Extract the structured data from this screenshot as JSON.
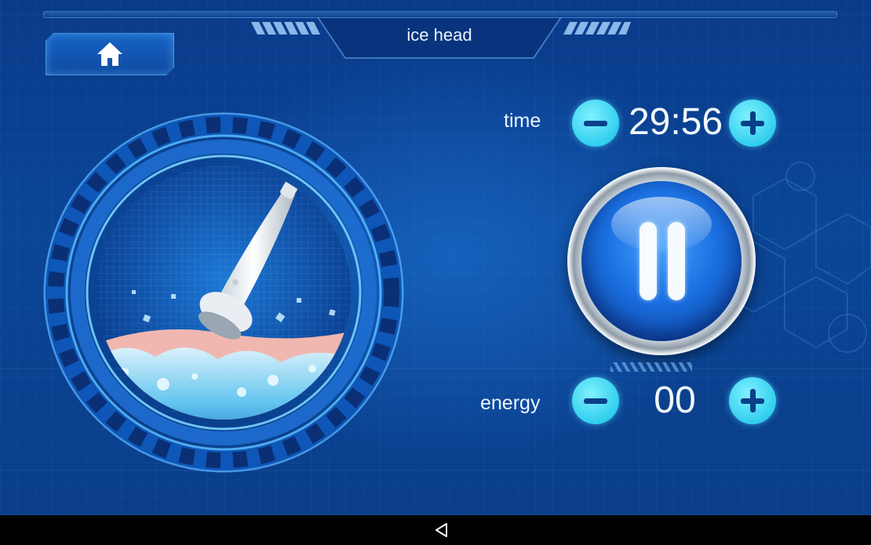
{
  "header": {
    "title": "ice head",
    "home_icon": "home-icon"
  },
  "time": {
    "label": "time",
    "value": "29:56",
    "decrease_icon": "minus-icon",
    "increase_icon": "plus-icon"
  },
  "energy": {
    "label": "energy",
    "value": "00",
    "decrease_icon": "minus-icon",
    "increase_icon": "plus-icon"
  },
  "control": {
    "pause_icon": "pause-icon"
  },
  "illustration": {
    "subject": "ice-head-handpiece-image"
  },
  "navbar": {
    "back_icon": "back-triangle-icon"
  },
  "colors": {
    "background": "#0b3e8c",
    "accent": "#32cfee",
    "text": "#eaf4ff"
  }
}
